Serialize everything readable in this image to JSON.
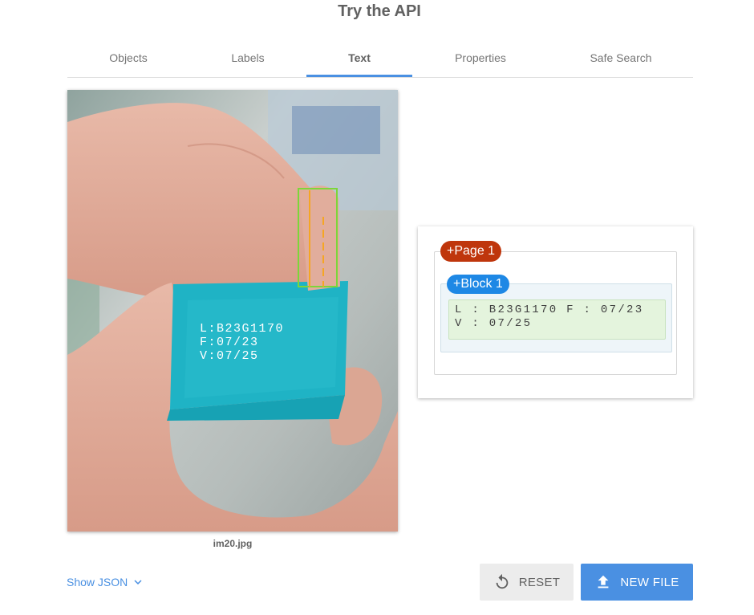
{
  "header": {
    "title": "Try the API"
  },
  "tabs": [
    {
      "label": "Objects"
    },
    {
      "label": "Labels"
    },
    {
      "label": "Text"
    },
    {
      "label": "Properties"
    },
    {
      "label": "Safe Search"
    }
  ],
  "active_tab": "Text",
  "image": {
    "filename": "im20.jpg",
    "box_text_lines": [
      "L:B23G1170",
      "F:07/23",
      "V:07/25"
    ]
  },
  "result": {
    "page_label": "+Page 1",
    "block_label": "+Block 1",
    "paragraph_text": "L : B23G1170 F : 07/23 V : 07/25"
  },
  "footer": {
    "show_json_label": "Show JSON",
    "reset_label": "RESET",
    "new_file_label": "NEW FILE"
  },
  "colors": {
    "accent": "#4a90e2",
    "page_chip": "#bf360c",
    "block_chip": "#1e88e5",
    "box_teal": "#1fb3c5"
  },
  "icons": {
    "show_json": "chevron-down-icon",
    "reset": "reset-icon",
    "new_file": "upload-icon"
  }
}
